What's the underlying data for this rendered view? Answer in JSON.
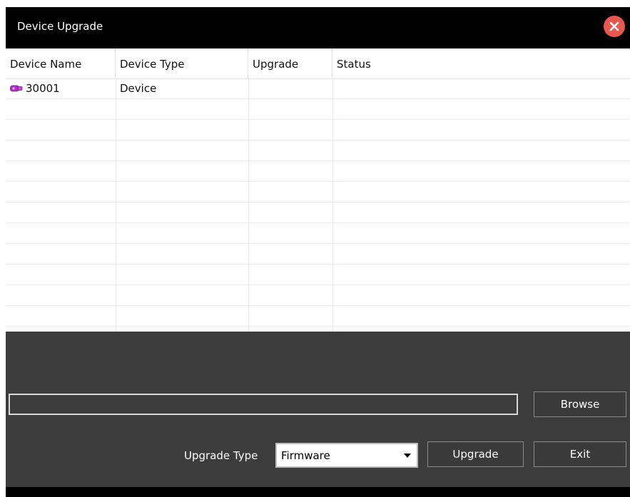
{
  "window": {
    "title": "Device Upgrade"
  },
  "table": {
    "columns": [
      "Device Name",
      "Device Type",
      "Upgrade",
      "Status"
    ],
    "rows": [
      {
        "device_name": "30001",
        "device_type": "Device",
        "upgrade": "",
        "status": ""
      }
    ]
  },
  "form": {
    "file_path": {
      "value": "",
      "placeholder": ""
    },
    "browse_label": "Browse",
    "upgrade_type_label": "Upgrade Type",
    "upgrade_type_value": "Firmware",
    "upgrade_label": "Upgrade",
    "exit_label": "Exit"
  },
  "icons": {
    "close": "close-icon",
    "device": "camera-device-icon",
    "dropdown": "dropdown-arrow-icon"
  },
  "colors": {
    "title_bar": "#000000",
    "panel": "#3c3c3c",
    "close_button": "#e8584e",
    "device_icon": "#b02fc9"
  }
}
